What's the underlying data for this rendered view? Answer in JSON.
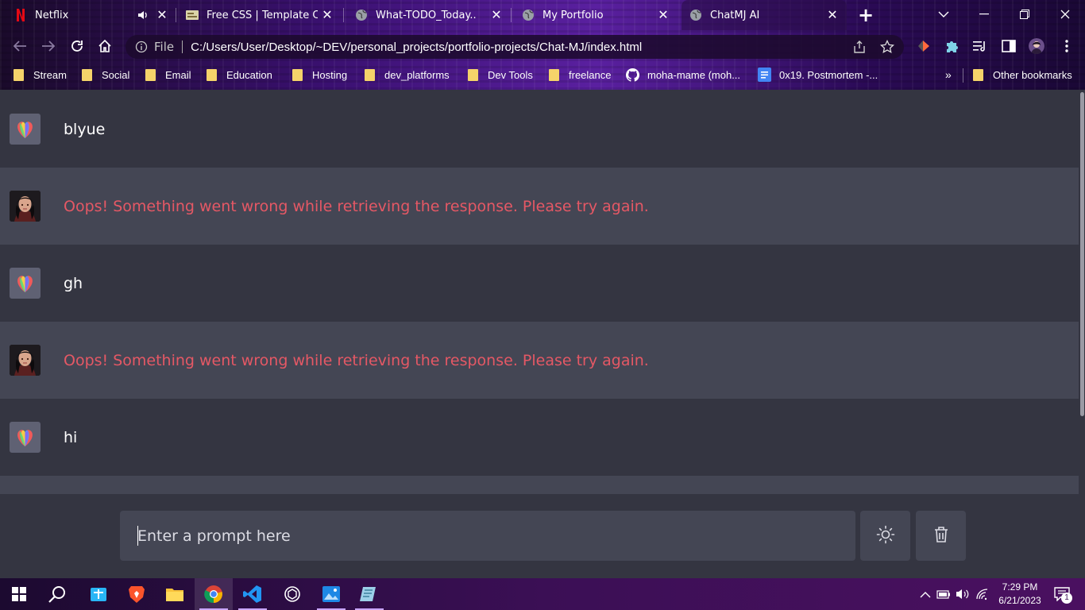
{
  "browser": {
    "tabs": [
      {
        "title": "Netflix",
        "icon": "netflix-icon",
        "audio": true
      },
      {
        "title": "Free CSS | Template Cat",
        "icon": "freecss-icon"
      },
      {
        "title": "What-TODO_Today..",
        "icon": "globe-icon"
      },
      {
        "title": "My Portfolio",
        "icon": "globe-icon"
      },
      {
        "title": "ChatMJ AI",
        "icon": "globe-icon",
        "active": true
      }
    ],
    "new_tab_label": "+",
    "omnibox": {
      "protocol": "File",
      "url": "C:/Users/User/Desktop/~DEV/personal_projects/portfolio-projects/Chat-MJ/index.html"
    },
    "bookmarks": [
      {
        "label": "Stream",
        "type": "folder"
      },
      {
        "label": "Social",
        "type": "folder"
      },
      {
        "label": "Email",
        "type": "folder"
      },
      {
        "label": "Education",
        "type": "folder"
      },
      {
        "label": "Hosting",
        "type": "folder"
      },
      {
        "label": "dev_platforms",
        "type": "folder"
      },
      {
        "label": "Dev Tools",
        "type": "folder"
      },
      {
        "label": "freelance",
        "type": "folder"
      },
      {
        "label": "moha-mame (moh...",
        "type": "github"
      },
      {
        "label": "0x19. Postmortem -...",
        "type": "doc"
      }
    ],
    "bookmarks_overflow": "»",
    "other_bookmarks": "Other bookmarks"
  },
  "chat": {
    "messages": [
      {
        "role": "user",
        "text": "blyue"
      },
      {
        "role": "bot",
        "text": "Oops! Something went wrong while retrieving the response. Please try again.",
        "error": true
      },
      {
        "role": "user",
        "text": "gh"
      },
      {
        "role": "bot",
        "text": "Oops! Something went wrong while retrieving the response. Please try again.",
        "error": true
      },
      {
        "role": "user",
        "text": "hi"
      }
    ]
  },
  "input": {
    "placeholder": "Enter a prompt here",
    "value": "",
    "theme_button_icon": "sun-icon",
    "delete_button_icon": "trash-icon"
  },
  "colors": {
    "user_row_bg": "#343541",
    "bot_row_bg": "#444654",
    "error_text": "#e55865",
    "input_bg": "#444654"
  },
  "taskbar": {
    "apps": [
      "windows-start-icon",
      "search-icon",
      "store-icon",
      "brave-icon",
      "file-explorer-icon",
      "chrome-icon",
      "vscode-icon",
      "chatgpt-icon",
      "photos-icon",
      "notes-icon"
    ],
    "clock_time": "7:29 PM",
    "clock_date": "6/21/2023",
    "notification_count": "1"
  }
}
